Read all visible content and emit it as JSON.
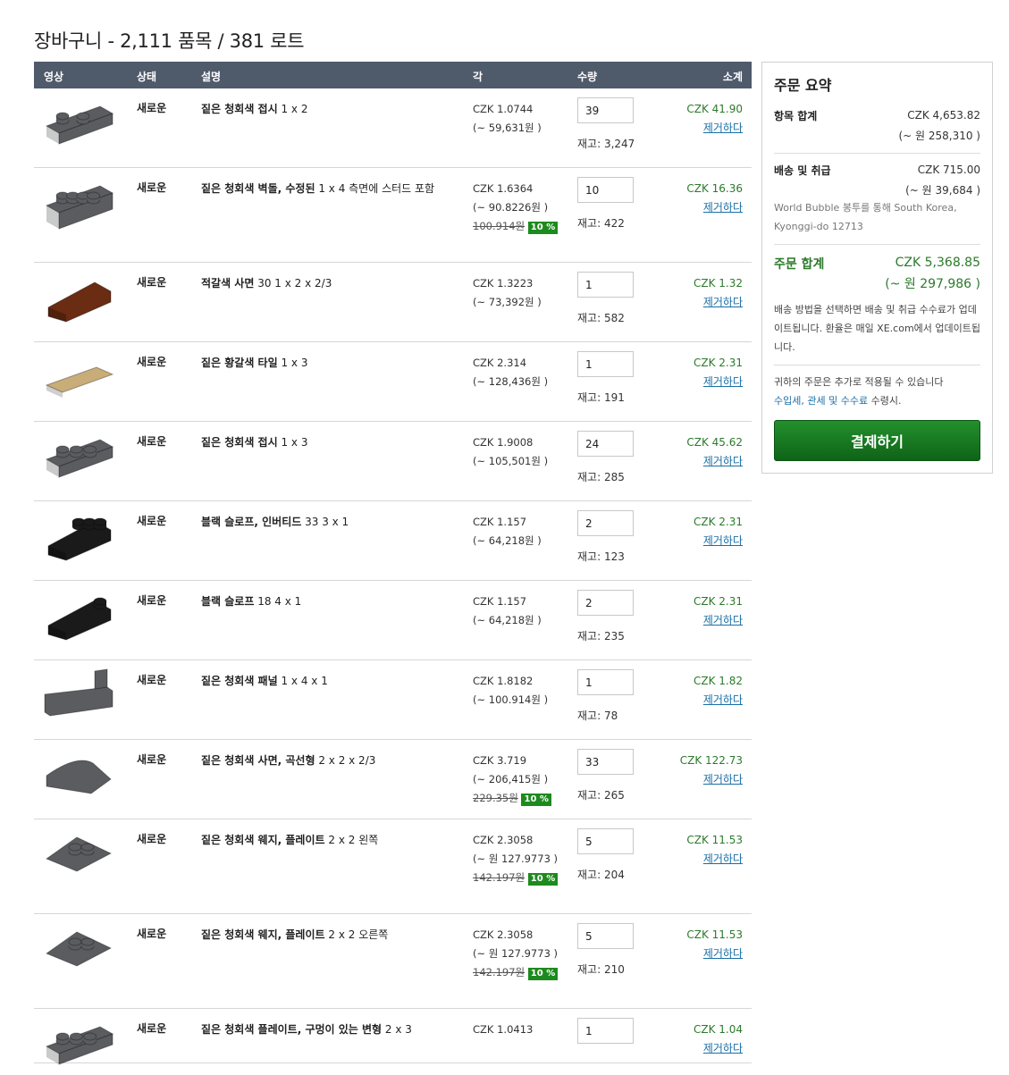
{
  "page": {
    "title": "장바구니 - 2,111 품목 / 381 로트"
  },
  "table": {
    "headers": {
      "image": "영상",
      "condition": "상태",
      "description": "설명",
      "each": "각",
      "qty": "수량",
      "subtotal": "소계"
    }
  },
  "colors": {
    "header_bg": "#4f5a6b",
    "accent_green": "#2b7a2b",
    "link_blue": "#1a6fa5",
    "discount_green": "#1d8a1d"
  },
  "items": [
    {
      "condition": "새로운",
      "name": "짙은 청회색 접시",
      "dim": "1 x 2",
      "price": "CZK 1.0744",
      "local": "(~ 59,631원 )",
      "old_price": "",
      "discount": "",
      "qty": "39",
      "stock": "재고: 3,247",
      "subtotal": "CZK 41.90",
      "remove": "제거하다",
      "icon": "plate-1x2-icon",
      "color": "#5b5c60"
    },
    {
      "condition": "새로운",
      "name": "짙은 청회색 벽돌, 수정된",
      "dim": "1 x 4 측면에 스터드 포함",
      "price": "CZK 1.6364",
      "local": "(~ 90.8226원 )",
      "old_price": "100.914원",
      "discount": "10 %",
      "qty": "10",
      "stock": "재고: 422",
      "subtotal": "CZK 16.36",
      "remove": "제거하다",
      "icon": "brick-1x4-studs-side-icon",
      "color": "#5b5c60"
    },
    {
      "condition": "새로운",
      "name": "적갈색 사면",
      "dim": "30 1 x 2 x 2/3",
      "price": "CZK 1.3223",
      "local": "(~ 73,392원 )",
      "old_price": "",
      "discount": "",
      "qty": "1",
      "stock": "재고: 582",
      "subtotal": "CZK 1.32",
      "remove": "제거하다",
      "icon": "slope-30-icon",
      "color": "#6a2c12"
    },
    {
      "condition": "새로운",
      "name": "짙은 황갈색 타일",
      "dim": "1 x 3",
      "price": "CZK 2.314",
      "local": "(~ 128,436원 )",
      "old_price": "",
      "discount": "",
      "qty": "1",
      "stock": "재고: 191",
      "subtotal": "CZK 2.31",
      "remove": "제거하다",
      "icon": "tile-1x3-icon",
      "color": "#c9ad78"
    },
    {
      "condition": "새로운",
      "name": "짙은 청회색 접시",
      "dim": "1 x 3",
      "price": "CZK 1.9008",
      "local": "(~ 105,501원 )",
      "old_price": "",
      "discount": "",
      "qty": "24",
      "stock": "재고: 285",
      "subtotal": "CZK 45.62",
      "remove": "제거하다",
      "icon": "plate-1x3-icon",
      "color": "#5b5c60"
    },
    {
      "condition": "새로운",
      "name": "블랙 슬로프, 인버티드",
      "dim": "33 3 x 1",
      "price": "CZK 1.157",
      "local": "(~ 64,218원 )",
      "old_price": "",
      "discount": "",
      "qty": "2",
      "stock": "재고: 123",
      "subtotal": "CZK 2.31",
      "remove": "제거하다",
      "icon": "slope-inverted-icon",
      "color": "#1a1a1a"
    },
    {
      "condition": "새로운",
      "name": "블랙 슬로프",
      "dim": "18 4 x 1",
      "price": "CZK 1.157",
      "local": "(~ 64,218원 )",
      "old_price": "",
      "discount": "",
      "qty": "2",
      "stock": "재고: 235",
      "subtotal": "CZK 2.31",
      "remove": "제거하다",
      "icon": "slope-18-icon",
      "color": "#1a1a1a"
    },
    {
      "condition": "새로운",
      "name": "짙은 청회색 패널",
      "dim": "1 x 4 x 1",
      "price": "CZK 1.8182",
      "local": "(~ 100.914원 )",
      "old_price": "",
      "discount": "",
      "qty": "1",
      "stock": "재고: 78",
      "subtotal": "CZK 1.82",
      "remove": "제거하다",
      "icon": "panel-1x4-icon",
      "color": "#5b5c60"
    },
    {
      "condition": "새로운",
      "name": "짙은 청회색 사면, 곡선형",
      "dim": "2 x 2 x 2/3",
      "price": "CZK 3.719",
      "local": "(~ 206,415원 )",
      "old_price": "229.35원",
      "discount": "10 %",
      "qty": "33",
      "stock": "재고: 265",
      "subtotal": "CZK 122.73",
      "remove": "제거하다",
      "icon": "slope-curved-icon",
      "color": "#5b5c60"
    },
    {
      "condition": "새로운",
      "name": "짙은 청회색 웨지, 플레이트",
      "dim": "2 x 2 왼쪽",
      "price": "CZK 2.3058",
      "local": "(~ 원 127.9773 )",
      "old_price": "142.197원",
      "discount": "10 %",
      "qty": "5",
      "stock": "재고: 204",
      "subtotal": "CZK 11.53",
      "remove": "제거하다",
      "icon": "wedge-plate-left-icon",
      "color": "#5b5c60"
    },
    {
      "condition": "새로운",
      "name": "짙은 청회색 웨지, 플레이트",
      "dim": "2 x 2 오른쪽",
      "price": "CZK 2.3058",
      "local": "(~ 원 127.9773 )",
      "old_price": "142.197원",
      "discount": "10 %",
      "qty": "5",
      "stock": "재고: 210",
      "subtotal": "CZK 11.53",
      "remove": "제거하다",
      "icon": "wedge-plate-right-icon",
      "color": "#5b5c60"
    },
    {
      "condition": "새로운",
      "name": "짙은 청회색 플레이트, 구멍이 있는 변형",
      "dim": "2 x 3",
      "price": "CZK 1.0413",
      "local": "",
      "old_price": "",
      "discount": "",
      "qty": "1",
      "stock": "",
      "subtotal": "CZK 1.04",
      "remove": "제거하다",
      "icon": "plate-hole-icon",
      "color": "#5b5c60"
    }
  ],
  "summary": {
    "title": "주문 요약",
    "items_total_label": "항목 합계",
    "items_total": "CZK 4,653.82",
    "items_total_local": "(~ 원 258,310 )",
    "shipping_label": "배송 및 취급",
    "shipping": "CZK 715.00",
    "shipping_local": "(~ 원 39,684 )",
    "shipping_note": "World Bubble 봉투를 통해 South Korea, Kyonggi-do 12713",
    "order_total_label": "주문 합계",
    "order_total": "CZK 5,368.85",
    "order_total_local": "(~ 원 297,986 )",
    "rate_note": "배송 방법을 선택하면 배송 및 취급 수수료가 업데이트됩니다. 환율은 매일 XE.com에서 업데이트됩니다.",
    "tax_note_prefix": "귀하의 주문은 추가로 적용될 수 있습니다",
    "tax_link": "수입세, 관세 및 수수료",
    "tax_note_suffix": "수령시.",
    "checkout_label": "결제하기"
  }
}
